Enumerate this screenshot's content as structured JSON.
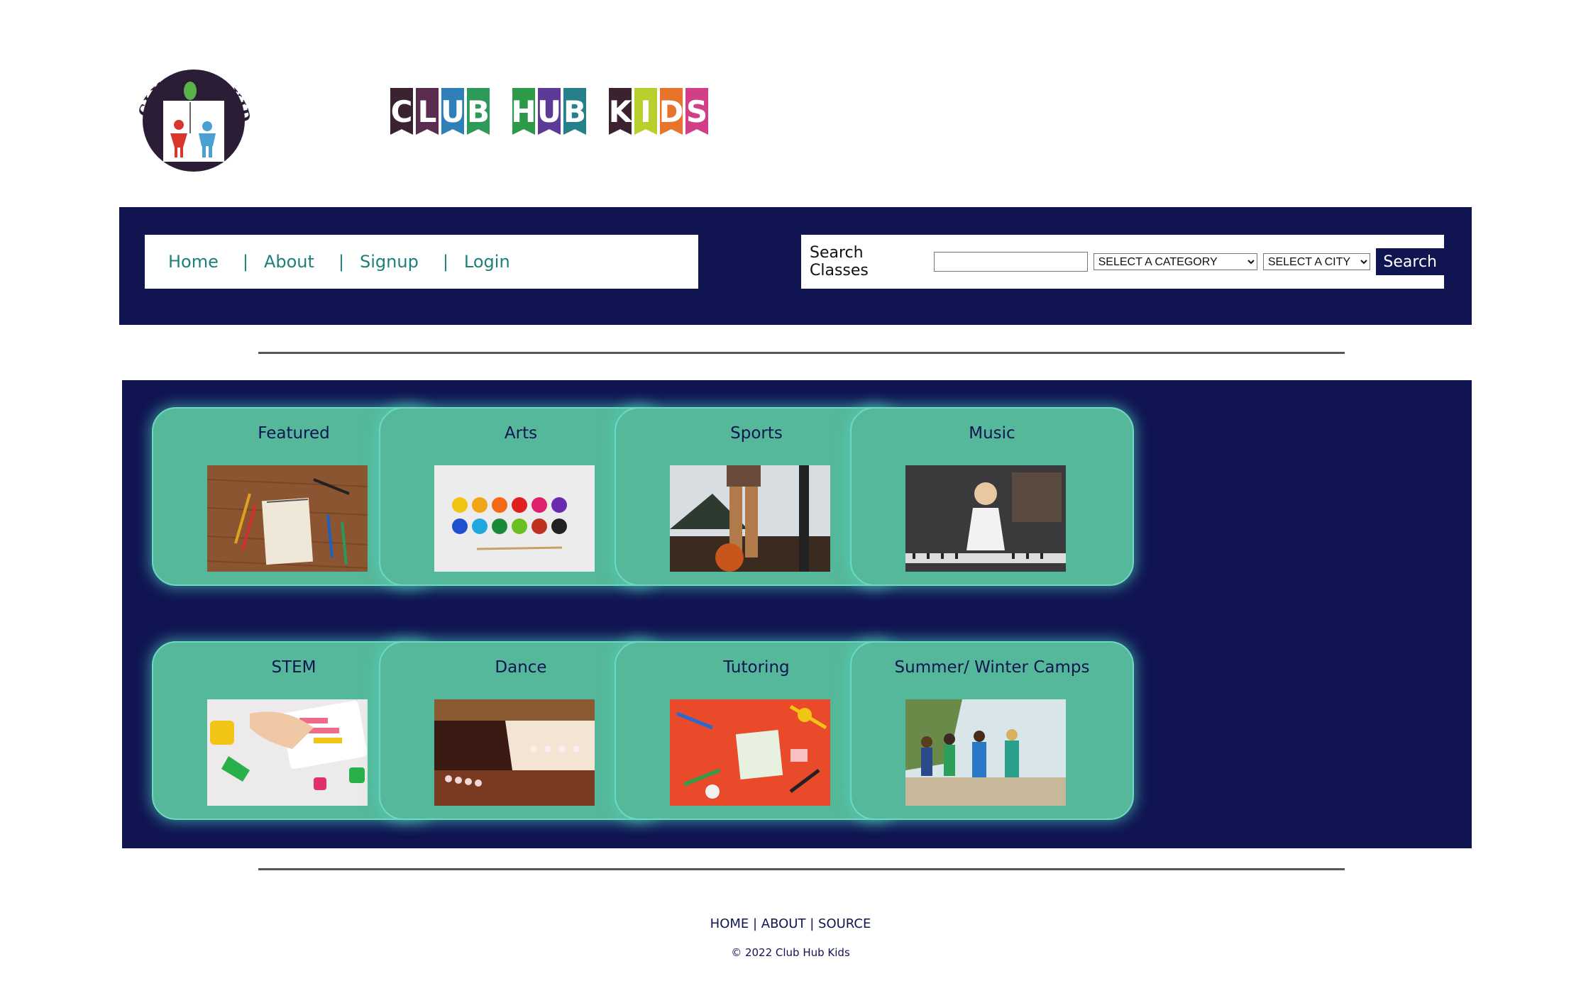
{
  "header": {
    "badge_logo_text": "CLUB HUB KIDS",
    "wordmark": [
      {
        "word": [
          "C",
          "L",
          "U",
          "B"
        ],
        "colors": [
          "#3b2230",
          "#5a2d50",
          "#2f7fb9",
          "#2e9a5a"
        ]
      },
      {
        "word": [
          "H",
          "U",
          "B"
        ],
        "colors": [
          "#2d9a4a",
          "#5c3a96",
          "#25808a"
        ]
      },
      {
        "word": [
          "K",
          "I",
          "D",
          "S"
        ],
        "colors": [
          "#3b2230",
          "#b9cf2d",
          "#e8732b",
          "#d33f86"
        ]
      }
    ]
  },
  "nav": {
    "links": [
      "Home",
      "About",
      "Signup",
      "Login"
    ],
    "separator": "|"
  },
  "search": {
    "label": "Search Classes",
    "input_value": "",
    "category_select": "SELECT A CATEGORY",
    "city_select": "SELECT A CITY",
    "button": "Search"
  },
  "categories": [
    {
      "title": "Featured",
      "image": "notebook-pencils-photo"
    },
    {
      "title": "Arts",
      "image": "paint-palette-photo"
    },
    {
      "title": "Sports",
      "image": "basketball-kid-photo"
    },
    {
      "title": "Music",
      "image": "girl-piano-photo"
    },
    {
      "title": "STEM",
      "image": "robot-coding-photo"
    },
    {
      "title": "Dance",
      "image": "ballet-studio-photo"
    },
    {
      "title": "Tutoring",
      "image": "school-supplies-photo"
    },
    {
      "title": "Summer/ Winter Camps",
      "image": "kids-camp-photo"
    }
  ],
  "footer": {
    "links": [
      "HOME",
      "ABOUT",
      "SOURCE"
    ],
    "copyright": "© 2022 Club Hub Kids"
  },
  "colors": {
    "navy": "#101552",
    "card_green": "#56b89a",
    "link_teal": "#1c8078"
  }
}
